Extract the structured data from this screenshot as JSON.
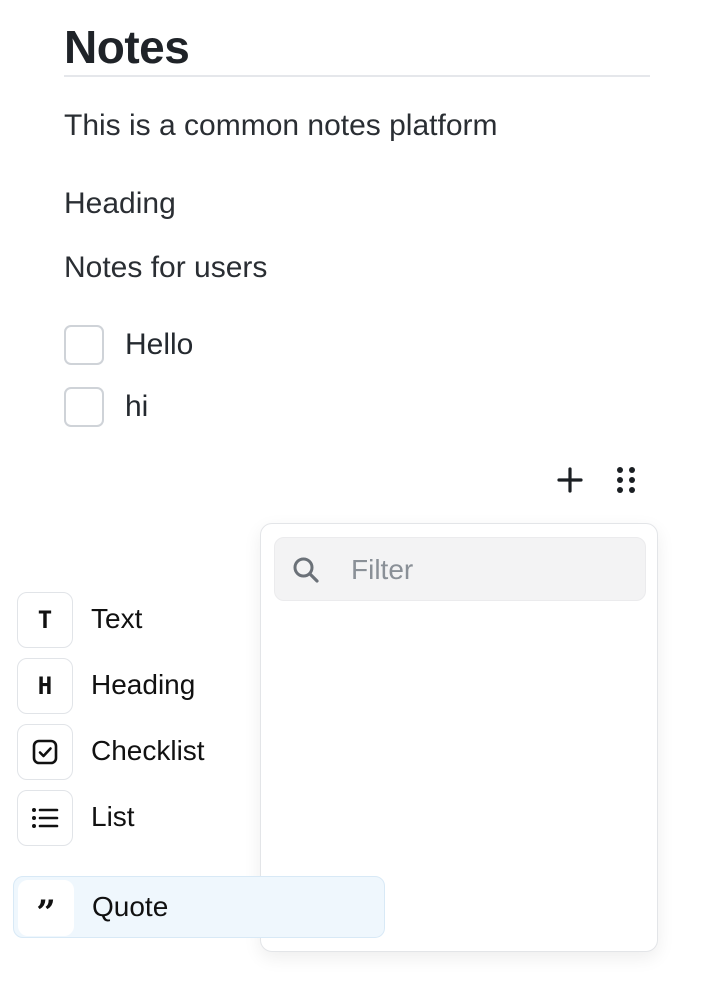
{
  "document": {
    "title": "Notes",
    "paragraphs": [
      "This is a common notes platform",
      "Heading",
      "Notes for users"
    ],
    "checklist": [
      {
        "label": "Hello",
        "checked": false
      },
      {
        "label": "hi",
        "checked": false
      }
    ]
  },
  "block_tools": {
    "add_icon": "plus-icon",
    "drag_icon": "drag-handle-icon"
  },
  "block_menu": {
    "filter_placeholder": "Filter",
    "filter_value": "",
    "items": [
      {
        "label": "Text",
        "icon": "text-icon",
        "glyph": "T"
      },
      {
        "label": "Heading",
        "icon": "heading-icon",
        "glyph": "H"
      },
      {
        "label": "Checklist",
        "icon": "checklist-icon",
        "glyph": ""
      },
      {
        "label": "List",
        "icon": "list-icon",
        "glyph": ""
      },
      {
        "label": "Quote",
        "icon": "quote-icon",
        "glyph": "”",
        "selected": true
      }
    ]
  },
  "colors": {
    "text": "#1f2328",
    "selected_bg": "#eff7fd",
    "filter_bg": "#f3f3f4"
  }
}
